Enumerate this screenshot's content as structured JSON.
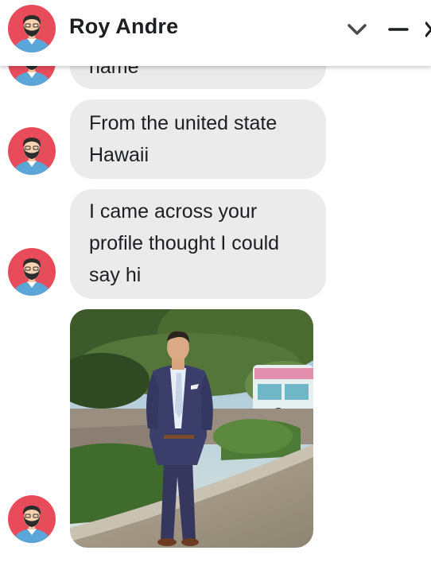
{
  "header": {
    "contact_name": "Roy Andre",
    "icons": [
      "avatar-icon",
      "chevron-down-icon",
      "minimize-icon",
      "close-icon"
    ]
  },
  "messages": [
    {
      "text": "name",
      "partial": true
    },
    {
      "text": "From the united state Hawaii"
    },
    {
      "text": "I came across your profile thought I could say hi"
    },
    {
      "type": "photo",
      "description": "man-in-suit-photo"
    }
  ],
  "colors": {
    "bubble_bg": "#ebebeb",
    "avatar_bg": "#e84c5a",
    "text": "#1c1e21"
  }
}
